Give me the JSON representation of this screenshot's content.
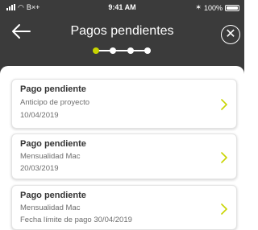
{
  "status_bar": {
    "carrier": "B×+",
    "time": "9:41 AM",
    "battery": "100%"
  },
  "header": {
    "title": "Pagos pendientes",
    "back_icon": "arrow-left-icon",
    "close_icon": "close-circle-icon"
  },
  "stepper": {
    "total_steps": 4,
    "current_step": 1,
    "active_color": "#c8d400"
  },
  "colors": {
    "header_bg": "#3b3b3b",
    "accent": "#c8d400"
  },
  "payments": [
    {
      "title": "Pago pendiente",
      "description": "Anticipo de proyecto",
      "date": "10/04/2019"
    },
    {
      "title": "Pago pendiente",
      "description": "Mensualidad Mac",
      "date": "20/03/2019"
    },
    {
      "title": "Pago pendiente",
      "description": "Mensualidad Mac",
      "date": "Fecha límite de pago 30/04/2019"
    }
  ]
}
